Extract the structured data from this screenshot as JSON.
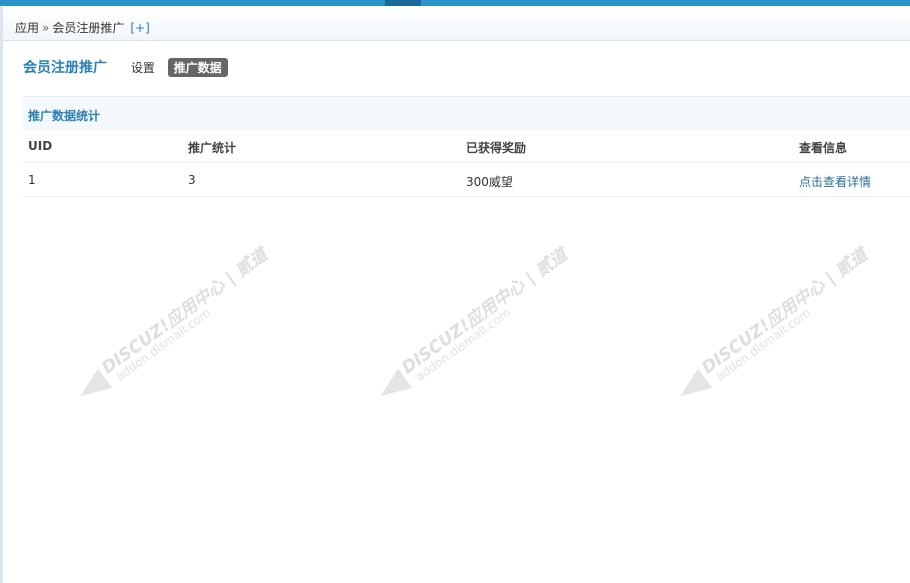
{
  "breadcrumb": {
    "root": "应用",
    "separator": "»",
    "current": "会员注册推广",
    "add": "[+]"
  },
  "plugin": {
    "title": "会员注册推广",
    "tabs": [
      {
        "label": "设置",
        "active": false
      },
      {
        "label": "推广数据",
        "active": true
      }
    ]
  },
  "section": {
    "title": "推广数据统计"
  },
  "table": {
    "headers": [
      "UID",
      "推广统计",
      "已获得奖励",
      "查看信息"
    ],
    "rows": [
      {
        "uid": "1",
        "count": "3",
        "reward": "300威望",
        "action": "点击查看详情"
      }
    ]
  },
  "watermark": {
    "brand": "DISCUZ!应用中心 | 贰道",
    "url": "addon.dismall.com"
  },
  "colors": {
    "accent": "#2a93c8",
    "link": "#2a6f9e",
    "title": "#2a7fb5",
    "active_tab": "#666666"
  }
}
